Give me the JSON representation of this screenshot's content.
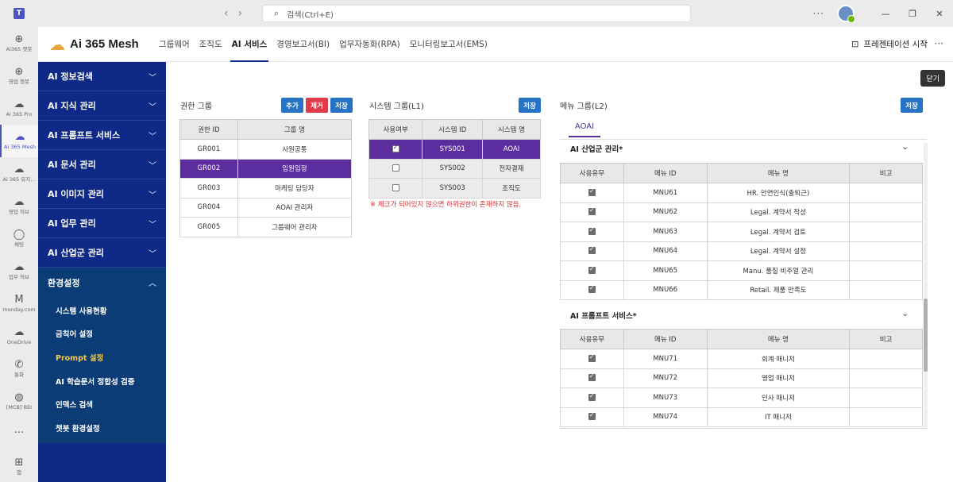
{
  "titlebar": {
    "logo": "T",
    "search_placeholder": "검색(Ctrl+E)",
    "more": "···",
    "minimize": "—",
    "restore": "❐",
    "close": "✕"
  },
  "rail": [
    {
      "icon": "bot-icon",
      "glyph": "⊕",
      "label": "Ai365 챗봇"
    },
    {
      "icon": "bot-icon",
      "glyph": "⊕",
      "label": "영업 챗봇"
    },
    {
      "icon": "cloud-icon",
      "glyph": "☁",
      "label": "Ai 365 Pro"
    },
    {
      "icon": "cloud-icon",
      "glyph": "☁",
      "label": "Ai 365 Mesh",
      "active": true
    },
    {
      "icon": "cloud-icon",
      "glyph": "☁",
      "label": "Ai 365 유지..."
    },
    {
      "icon": "cloud-icon",
      "glyph": "☁",
      "label": "영업 허브"
    },
    {
      "icon": "chat-icon",
      "glyph": "◯",
      "label": "채팅"
    },
    {
      "icon": "cloud-icon",
      "glyph": "☁",
      "label": "업무 허브"
    },
    {
      "icon": "monday-icon",
      "glyph": "M",
      "label": "monday.com"
    },
    {
      "icon": "onedrive-icon",
      "glyph": "☁",
      "label": "OneDrive"
    },
    {
      "icon": "phone-icon",
      "glyph": "✆",
      "label": "통화"
    },
    {
      "icon": "globe-icon",
      "glyph": "◍",
      "label": "[MCB] BEI"
    },
    {
      "icon": "more-icon",
      "glyph": "···",
      "label": ""
    },
    {
      "icon": "add-app-icon",
      "glyph": "⊞",
      "label": "앱"
    }
  ],
  "header": {
    "brand": "Ai 365 Mesh",
    "nav": [
      "그룹웨어",
      "조직도",
      "AI 서비스",
      "경영보고서(BI)",
      "업무자동화(RPA)",
      "모니터링보고서(EMS)"
    ],
    "active_nav": "AI 서비스",
    "present_label": "프레젠테이션 시작",
    "more": "···"
  },
  "sidebar": {
    "items": [
      "AI 정보검색",
      "AI 지식 관리",
      "AI 프롬프트 서비스",
      "AI 문서 관리",
      "AI 이미지 관리",
      "AI 업무 관리",
      "AI 산업군 관리"
    ],
    "open_item": "환경설정",
    "sub_items": [
      "시스템 사용현황",
      "금칙어 설정",
      "Prompt 설정",
      "AI 학습문서 정합성 검증",
      "인덱스 검색",
      "챗봇 환경설정"
    ],
    "active_sub": "Prompt 설정"
  },
  "close_label": "닫기",
  "auth_group": {
    "title": "권한 그룹",
    "btn_add": "추가",
    "btn_remove": "제거",
    "btn_save": "저장",
    "columns": [
      "권한 ID",
      "그룹 명"
    ],
    "rows": [
      [
        "GR001",
        "사원공통"
      ],
      [
        "GR002",
        "임원임정"
      ],
      [
        "GR003",
        "마케팅 담당자"
      ],
      [
        "GR004",
        "AOAI 관리자"
      ],
      [
        "GR005",
        "그룹웨어 관리자"
      ]
    ],
    "selected_index": 1
  },
  "system_group": {
    "title": "시스템 그룹(L1)",
    "btn_save": "저장",
    "columns": [
      "사용여부",
      "시스템 ID",
      "시스템 명"
    ],
    "rows": [
      {
        "checked": true,
        "id": "SYS001",
        "name": "AOAI"
      },
      {
        "checked": false,
        "id": "SYS002",
        "name": "전자결재"
      },
      {
        "checked": false,
        "id": "SYS003",
        "name": "조직도"
      }
    ],
    "selected_index": 0,
    "warning": "※ 체크가 되어있지 않으면 하위권한이 존재하지 않음."
  },
  "menu_group": {
    "title": "메뉴 그룹(L2)",
    "btn_save": "저장",
    "tab": "AOAI",
    "columns": [
      "사용유무",
      "메뉴 ID",
      "메뉴 명",
      "비고"
    ],
    "groups": [
      {
        "name": "AI 산업군 관리*",
        "rows": [
          {
            "checked": true,
            "id": "MNU61",
            "name": "HR. 안면인식(출퇴근)",
            "note": ""
          },
          {
            "checked": true,
            "id": "MNU62",
            "name": "Legal. 계약서 작성",
            "note": ""
          },
          {
            "checked": true,
            "id": "MNU63",
            "name": "Legal. 계약서 검토",
            "note": ""
          },
          {
            "checked": true,
            "id": "MNU64",
            "name": "Legal. 계약서 설정",
            "note": ""
          },
          {
            "checked": true,
            "id": "MNU65",
            "name": "Manu. 품질 비주얼 관리",
            "note": ""
          },
          {
            "checked": true,
            "id": "MNU66",
            "name": "Retail. 제품 만족도",
            "note": ""
          }
        ]
      },
      {
        "name": "AI 프롬프트 서비스*",
        "rows": [
          {
            "checked": true,
            "id": "MNU71",
            "name": "회계 매니저",
            "note": ""
          },
          {
            "checked": true,
            "id": "MNU72",
            "name": "영업 매니저",
            "note": ""
          },
          {
            "checked": true,
            "id": "MNU73",
            "name": "인사 매니저",
            "note": ""
          },
          {
            "checked": true,
            "id": "MNU74",
            "name": "IT 매니저",
            "note": ""
          }
        ]
      }
    ]
  }
}
